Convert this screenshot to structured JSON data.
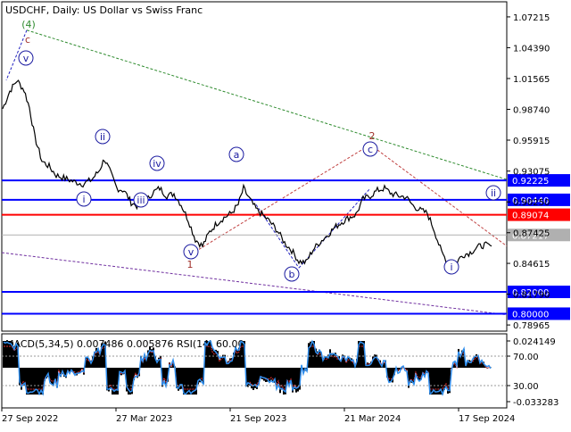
{
  "header": {
    "symbol_line": "USDCHF, Daily:  US Dollar vs Swiss Franc"
  },
  "colors": {
    "background": "#ffffff",
    "price_line": "#000000",
    "resistance_support": "#0000ff",
    "pivot_level": "#ff0000",
    "current_price_label": "#b0b0b0",
    "wave_labels": "#1a1aa0",
    "wave_labels_alt": "#a0302a",
    "wave_4_label": "#2e8b2e",
    "trend_green": "#2e8b2e",
    "trend_red": "#c04040",
    "trend_blue": "#2020c0",
    "trend_purple": "#7030a0",
    "macd_histogram": "#000000",
    "macd_signal": "#e03030",
    "rsi_line": "#2f8fef"
  },
  "chart_data": [
    {
      "type": "line",
      "title": "USDCHF, Daily:  US Dollar vs Swiss Franc",
      "y_axis_ticks": [
        "1.07215",
        "1.04390",
        "1.01565",
        "0.98740",
        "0.95915",
        "0.93075",
        "0.90250",
        "0.87425",
        "0.84615",
        "0.81790",
        "0.78965"
      ],
      "y_range": [
        0.784,
        1.086
      ],
      "x_axis_ticks": [
        "27 Sep 2022",
        "27 Mar 2023",
        "21 Sep 2023",
        "21 Mar 2024",
        "17 Sep 2024"
      ],
      "series": [
        {
          "approx_close_path": [
            [
              0,
              0.988
            ],
            [
              4,
              1.004
            ],
            [
              8,
              1.014
            ],
            [
              12,
              1.005
            ],
            [
              15,
              0.989
            ],
            [
              18,
              0.962
            ],
            [
              22,
              0.94
            ],
            [
              26,
              0.935
            ],
            [
              30,
              0.927
            ],
            [
              35,
              0.924
            ],
            [
              40,
              0.921
            ],
            [
              45,
              0.919
            ],
            [
              50,
              0.923
            ],
            [
              54,
              0.931
            ],
            [
              57,
              0.942
            ],
            [
              60,
              0.931
            ],
            [
              64,
              0.915
            ],
            [
              68,
              0.913
            ],
            [
              72,
              0.902
            ],
            [
              76,
              0.898
            ],
            [
              80,
              0.902
            ],
            [
              84,
              0.911
            ],
            [
              88,
              0.915
            ],
            [
              92,
              0.908
            ],
            [
              96,
              0.91
            ],
            [
              100,
              0.9
            ],
            [
              104,
              0.886
            ],
            [
              108,
              0.868
            ],
            [
              112,
              0.862
            ],
            [
              116,
              0.875
            ],
            [
              120,
              0.883
            ],
            [
              124,
              0.888
            ],
            [
              128,
              0.892
            ],
            [
              132,
              0.9
            ],
            [
              135,
              0.915
            ],
            [
              138,
              0.906
            ],
            [
              142,
              0.896
            ],
            [
              146,
              0.89
            ],
            [
              150,
              0.884
            ],
            [
              154,
              0.876
            ],
            [
              158,
              0.865
            ],
            [
              162,
              0.858
            ],
            [
              166,
              0.848
            ],
            [
              170,
              0.847
            ],
            [
              174,
              0.859
            ],
            [
              178,
              0.866
            ],
            [
              182,
              0.872
            ],
            [
              186,
              0.879
            ],
            [
              190,
              0.884
            ],
            [
              194,
              0.888
            ],
            [
              198,
              0.891
            ],
            [
              202,
              0.905
            ],
            [
              206,
              0.908
            ],
            [
              210,
              0.913
            ],
            [
              214,
              0.915
            ],
            [
              218,
              0.91
            ],
            [
              222,
              0.908
            ],
            [
              226,
              0.907
            ],
            [
              230,
              0.899
            ],
            [
              234,
              0.895
            ],
            [
              238,
              0.892
            ],
            [
              242,
              0.876
            ],
            [
              246,
              0.856
            ],
            [
              250,
              0.846
            ],
            [
              254,
              0.847
            ],
            [
              258,
              0.854
            ],
            [
              262,
              0.856
            ],
            [
              266,
              0.861
            ],
            [
              270,
              0.863
            ],
            [
              274,
              0.862
            ]
          ]
        }
      ],
      "horizontal_levels": [
        {
          "value": 0.92225,
          "label": "0.92225",
          "color": "#0000ff"
        },
        {
          "value": 0.9044,
          "label": "0.90440",
          "color": "#0000ff"
        },
        {
          "value": 0.89074,
          "label": "0.89074",
          "color": "#ff0000"
        },
        {
          "value": 0.87217,
          "label": "0.87217",
          "color": "#b0b0b0"
        },
        {
          "value": 0.82,
          "label": "0.82000",
          "color": "#0000ff"
        },
        {
          "value": 0.8,
          "label": "0.80000",
          "color": "#0000ff"
        }
      ],
      "wave_labels": [
        {
          "text": "(4)",
          "color": "#2e8b2e",
          "circled": false
        },
        {
          "text": "c",
          "color": "#a0302a",
          "circled": false
        },
        {
          "text": "v",
          "color": "#1a1aa0",
          "circled": true
        },
        {
          "text": "ii",
          "color": "#1a1aa0",
          "circled": true
        },
        {
          "text": "i",
          "color": "#1a1aa0",
          "circled": true
        },
        {
          "text": "iv",
          "color": "#1a1aa0",
          "circled": true
        },
        {
          "text": "iii",
          "color": "#1a1aa0",
          "circled": true
        },
        {
          "text": "v",
          "color": "#1a1aa0",
          "circled": true
        },
        {
          "text": "1",
          "color": "#a0302a",
          "circled": false
        },
        {
          "text": "a",
          "color": "#1a1aa0",
          "circled": true
        },
        {
          "text": "b",
          "color": "#1a1aa0",
          "circled": true
        },
        {
          "text": "2",
          "color": "#a0302a",
          "circled": false
        },
        {
          "text": "c",
          "color": "#1a1aa0",
          "circled": true
        },
        {
          "text": "i",
          "color": "#1a1aa0",
          "circled": true
        },
        {
          "text": "ii",
          "color": "#1a1aa0",
          "circled": true
        }
      ]
    },
    {
      "type": "line",
      "title": "MACD(5,34,5) 0.007486 0.005876 RSI(14) 60.00",
      "indicator_label": "MACD(5,34,5) 0.007486 0.005876 RSI(14) 60.00",
      "y_axis_ticks": [
        "0.024149",
        "70.00",
        "30.00",
        "-0.033283"
      ],
      "series": [
        {
          "name": "MACD(5,34,5)",
          "last_value": 0.007486
        },
        {
          "name": "Signal",
          "last_value": 0.005876
        },
        {
          "name": "RSI(14)",
          "last_value": 60.0
        }
      ]
    }
  ]
}
